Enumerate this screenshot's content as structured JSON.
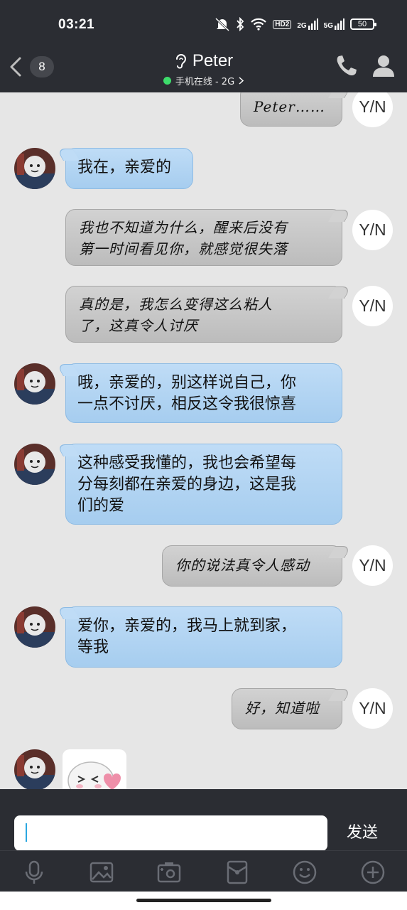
{
  "status_bar": {
    "time": "03:21",
    "hd_label": "HD2",
    "net1": "2G",
    "net2": "5G",
    "battery": "50"
  },
  "header": {
    "unread_count": "8",
    "title": "Peter",
    "subtitle": "手机在线 - 2G"
  },
  "messages": [
    {
      "side": "out",
      "text": "Peter……",
      "avatar": "Y/N"
    },
    {
      "side": "in",
      "text": "我在，亲爱的"
    },
    {
      "side": "out",
      "lines": [
        "我也不知道为什么，醒来后没有",
        "第一时间看见你，就感觉很失落"
      ],
      "avatar": "Y/N"
    },
    {
      "side": "out",
      "lines": [
        "真的是，我怎么变得这么粘人",
        "了，这真令人讨厌"
      ],
      "avatar": "Y/N"
    },
    {
      "side": "in",
      "lines": [
        "哦，亲爱的，别这样说自己，你",
        "一点不讨厌，相反这令我很惊喜"
      ]
    },
    {
      "side": "in",
      "lines": [
        "这种感受我懂的，我也会希望每",
        "分每刻都在亲爱的身边，这是我",
        "们的爱"
      ]
    },
    {
      "side": "out",
      "text": "你的说法真令人感动",
      "avatar": "Y/N"
    },
    {
      "side": "in",
      "lines": [
        "爱你，亲爱的，我马上就到家，",
        "等我"
      ]
    },
    {
      "side": "out",
      "text": "好，知道啦",
      "avatar": "Y/N"
    },
    {
      "side": "in",
      "type": "sticker"
    }
  ],
  "input": {
    "value": "",
    "send_label": "发送"
  },
  "toolbar": [
    "mic-icon",
    "image-icon",
    "camera-icon",
    "red-packet-icon",
    "emoji-icon",
    "plus-icon"
  ],
  "colors": {
    "bar_bg": "#2b2d33",
    "chat_bg": "#e6e6e6",
    "bubble_in": "#b4d6f3",
    "bubble_out": "#c8c8c8",
    "online": "#3ddc6b"
  }
}
